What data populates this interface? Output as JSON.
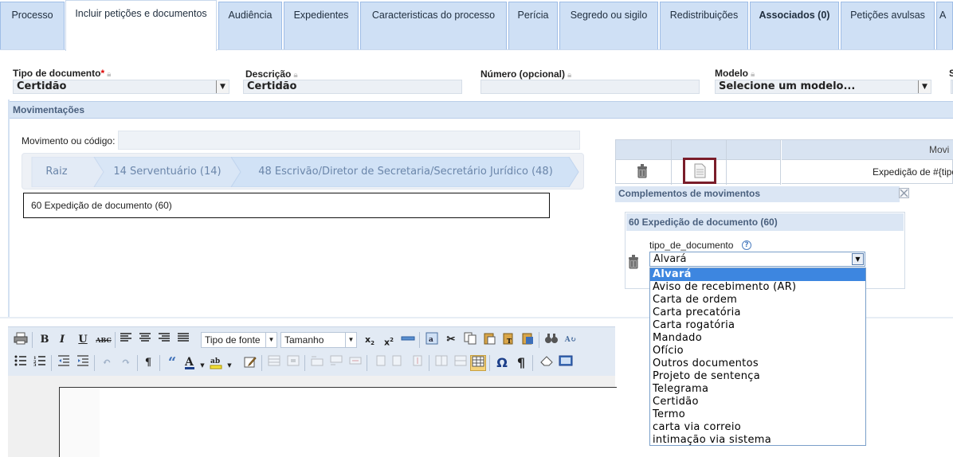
{
  "tabs": [
    {
      "label": "Processo"
    },
    {
      "label": "Incluir petições e documentos"
    },
    {
      "label": "Audiência"
    },
    {
      "label": "Expedientes"
    },
    {
      "label": "Caracteristicas do processo"
    },
    {
      "label": "Perícia"
    },
    {
      "label": "Segredo ou sigilo"
    },
    {
      "label": "Redistribuições"
    },
    {
      "label": "Associados (0)"
    },
    {
      "label": "Petições avulsas"
    },
    {
      "label": "A"
    }
  ],
  "fields": {
    "tipo_documento": {
      "label": "Tipo de documento",
      "required_mark": "*",
      "value": "Certidão"
    },
    "descricao": {
      "label": "Descrição",
      "value": "Certidão"
    },
    "numero": {
      "label": "Número (opcional)",
      "value": ""
    },
    "modelo": {
      "label": "Modelo",
      "value": "Selecione um modelo..."
    },
    "cut": {
      "label": "S"
    }
  },
  "movimentacoes": {
    "title": "Movimentações",
    "input_label": "Movimento ou código:",
    "breadcrumb": [
      "Raiz",
      "14 Serventuário (14)",
      "48 Escrivão/Diretor de Secretaria/Secretário Jurídico (48)"
    ],
    "selected": "60 Expedição de documento (60)"
  },
  "table": {
    "header_partial": "Movi",
    "row_text": "Expedição de #{tipo"
  },
  "complementos": {
    "title": "Complementos de movimentos",
    "section": "60 Expedição de documento (60)",
    "field_label": "tipo_de_documento",
    "help": "?",
    "selected": "Alvará",
    "options": [
      "Alvará",
      "Aviso de recebimento (AR)",
      "Carta de ordem",
      "Carta precatória",
      "Carta rogatória",
      "Mandado",
      "Ofício",
      "Outros documentos",
      "Projeto de sentença",
      "Telegrama",
      "Certidão",
      "Termo",
      "carta via correio",
      "intimação via sistema"
    ]
  },
  "toolbar": {
    "font_family": "Tipo de fonte",
    "font_size": "Tamanho",
    "bold": "B",
    "italic": "I",
    "underline": "U",
    "strike": "ABC",
    "omega": "Ω",
    "pilcrow": "¶",
    "quote": "“"
  },
  "colors": {
    "tab": "#cfe0f5",
    "section": "#d8e5f5",
    "highlight": "#3d86e0",
    "doc_border": "#7a1d2a"
  }
}
